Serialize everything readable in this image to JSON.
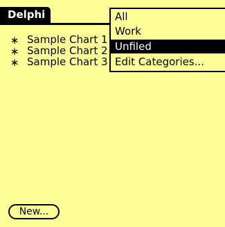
{
  "app": {
    "title": "Delphi"
  },
  "records": [
    {
      "bullet": "∗",
      "label": "Sample Chart 1"
    },
    {
      "bullet": "∗",
      "label": "Sample Chart 2"
    },
    {
      "bullet": "∗",
      "label": "Sample Chart 3"
    }
  ],
  "buttons": {
    "new_label": "New..."
  },
  "category_menu": {
    "items": [
      {
        "label": "All"
      },
      {
        "label": "Work"
      },
      {
        "label": "Unfiled",
        "selected": true
      },
      {
        "label": "Edit Categories..."
      }
    ]
  },
  "colors": {
    "screen_background": "#ffff99",
    "title_bar": "#000000",
    "selected_item": "#000000"
  }
}
